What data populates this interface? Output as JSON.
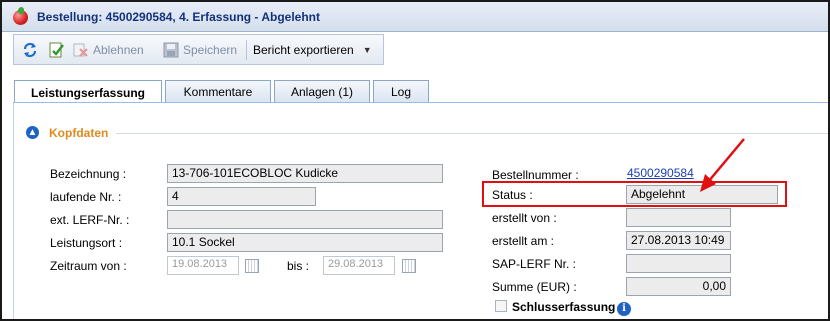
{
  "window": {
    "title": "Bestellung: 4500290584, 4. Erfassung - Abgelehnt"
  },
  "toolbar": {
    "reject_label": "Ablehnen",
    "save_label": "Speichern",
    "export_label": "Bericht exportieren"
  },
  "tabs": [
    {
      "label": "Leistungserfassung",
      "active": true
    },
    {
      "label": "Kommentare",
      "active": false
    },
    {
      "label": "Anlagen (1)",
      "active": false
    },
    {
      "label": "Log",
      "active": false
    }
  ],
  "section": {
    "title": "Kopfdaten"
  },
  "left": {
    "bezeichnung_label": "Bezeichnung :",
    "bezeichnung_value": "13-706-101ECOBLOC  Kudicke",
    "laufende_label": "laufende Nr. :",
    "laufende_value": "4",
    "ext_lerf_label": "ext. LERF-Nr. :",
    "ext_lerf_value": "",
    "leistungsort_label": "Leistungsort :",
    "leistungsort_value": "10.1 Sockel",
    "zeitraum_label": "Zeitraum von :",
    "date_from": "19.08.2013",
    "bis_label": "bis :",
    "date_to": "29.08.2013"
  },
  "right": {
    "bestellnummer_label": "Bestellnummer :",
    "bestellnummer_value": "4500290584",
    "status_label": "Status :",
    "status_value": "Abgelehnt",
    "erstellt_von_label": "erstellt von :",
    "erstellt_von_value": "",
    "erstellt_am_label": "erstellt am :",
    "erstellt_am_value": "27.08.2013 10:49",
    "sap_lerf_label": "SAP-LERF Nr. :",
    "sap_lerf_value": "",
    "summe_label": "Summe (EUR) :",
    "summe_value": "0,00",
    "schluss_label": "Schlusserfassung",
    "schluss_checked": false
  },
  "colors": {
    "highlight": "#e01010",
    "section_title": "#e08a1e",
    "link": "#1a3fb0"
  }
}
